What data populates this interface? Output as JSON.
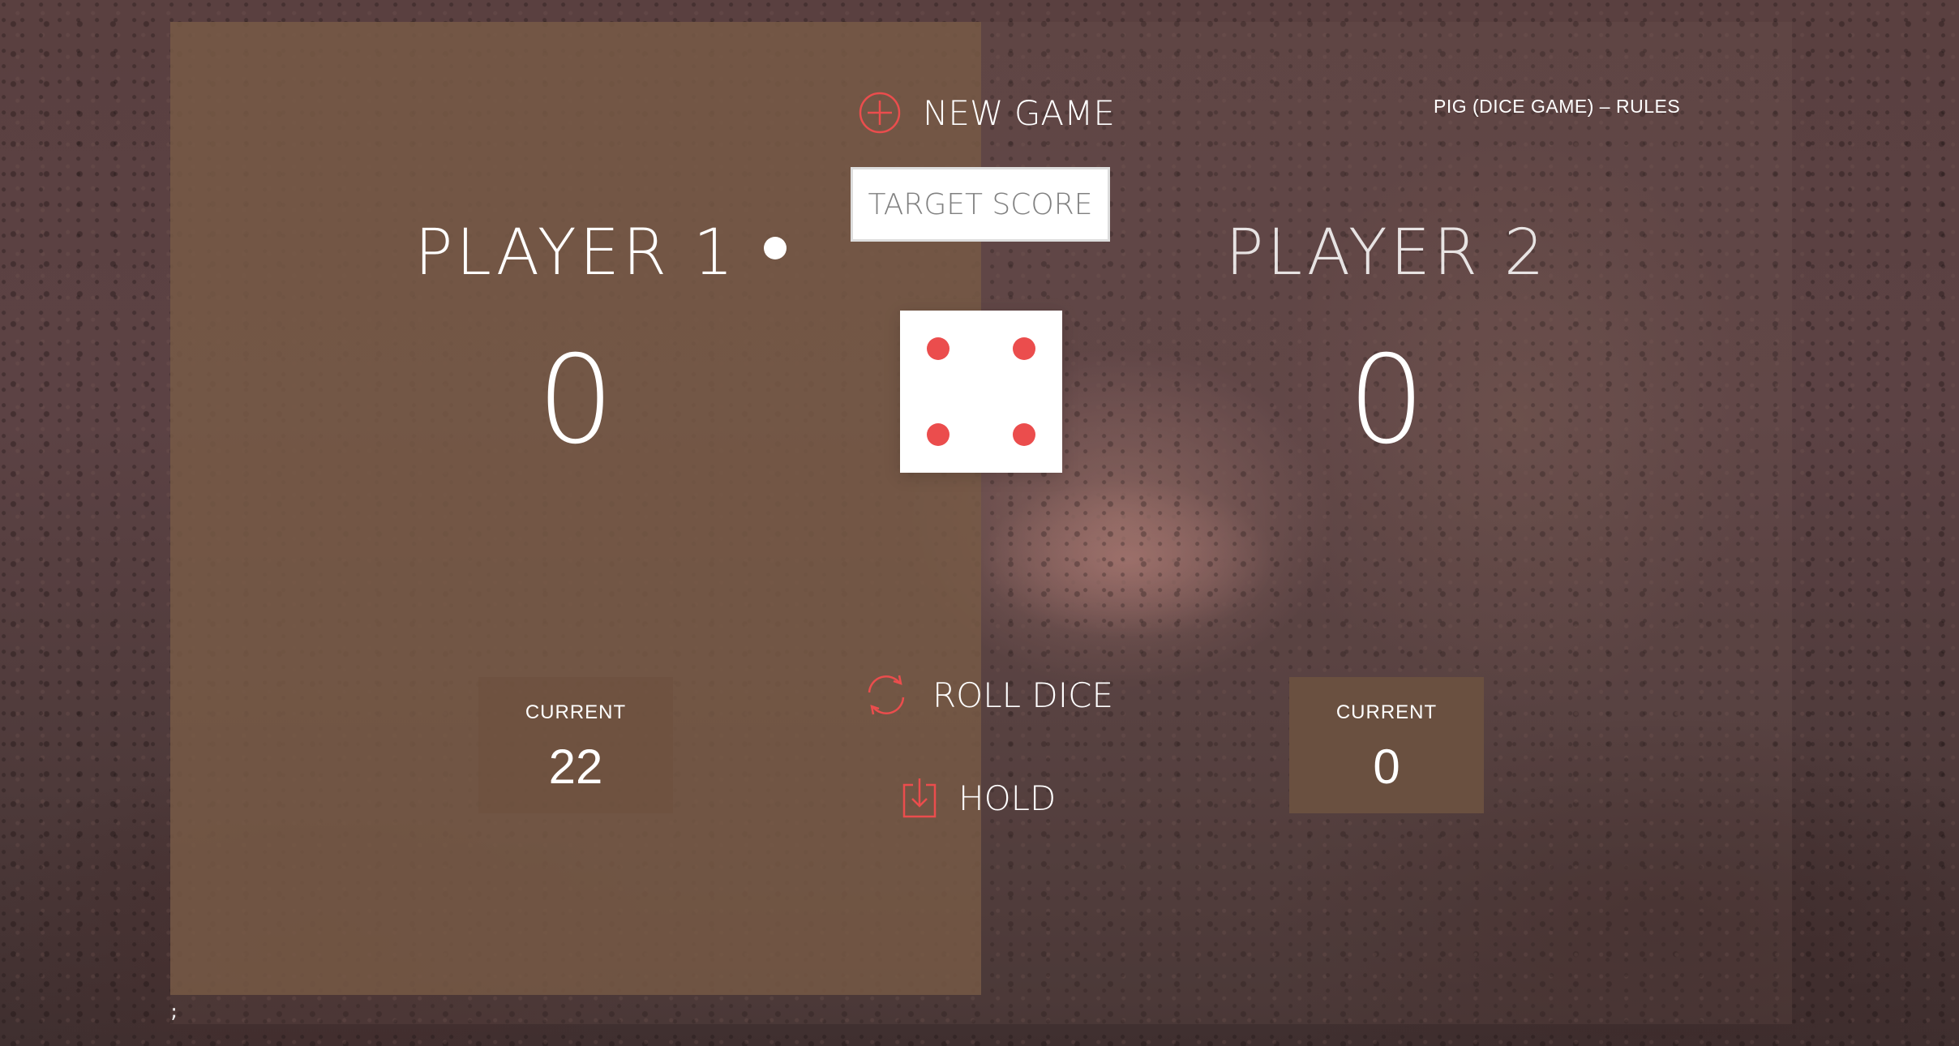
{
  "header": {
    "new_game_label": "NEW GAME",
    "rules_label": "PIG (DICE GAME) – RULES",
    "target_placeholder": "TARGET SCORE"
  },
  "players": [
    {
      "name": "PLAYER 1",
      "score": "0",
      "current_label": "CURRENT",
      "current": "22",
      "active": true
    },
    {
      "name": "PLAYER 2",
      "score": "0",
      "current_label": "CURRENT",
      "current": "0",
      "active": false
    }
  ],
  "dice": {
    "value": 4
  },
  "controls": {
    "roll_label": "ROLL DICE",
    "hold_label": "HOLD"
  },
  "footer": {
    "stray_text": ";"
  },
  "colors": {
    "accent": "#eb4d4d",
    "active_panel": "#785a46"
  },
  "icons": {
    "new": "plus-circle-icon",
    "roll": "refresh-icon",
    "hold": "download-icon"
  }
}
